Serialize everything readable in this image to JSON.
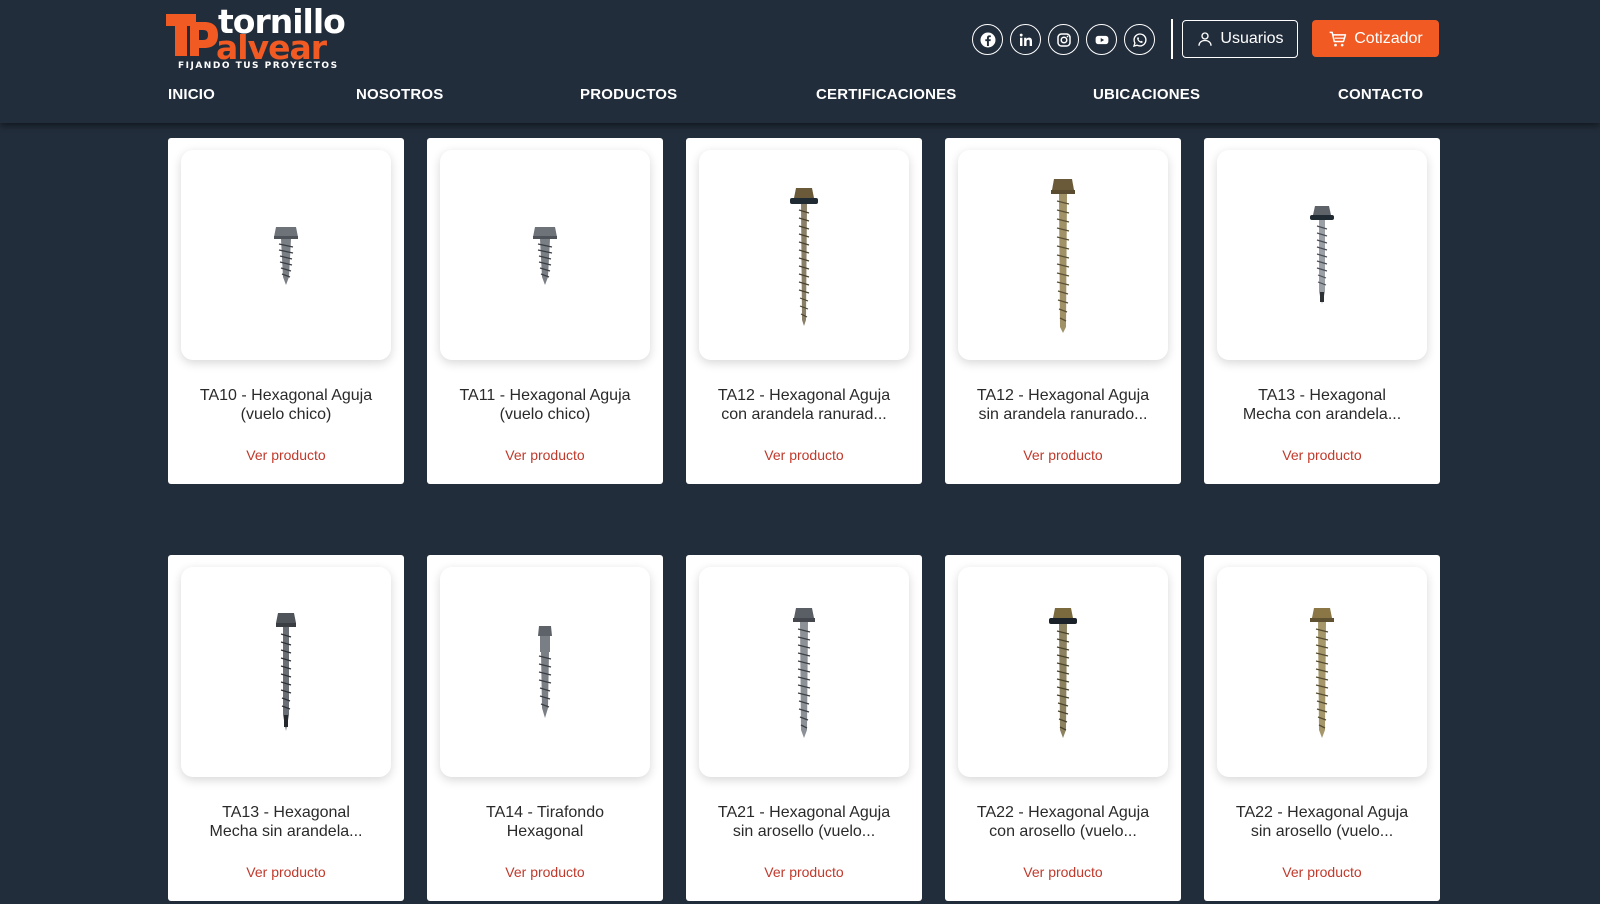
{
  "brand": {
    "name_line1": "tornillo",
    "name_line2": "alvear",
    "tagline": "FIJANDO TUS PROYECTOS",
    "accent_color": "#f15a22",
    "background_color": "#222d3b"
  },
  "social_icons": [
    "facebook-icon",
    "linkedin-icon",
    "instagram-icon",
    "youtube-icon",
    "whatsapp-icon"
  ],
  "header": {
    "users_label": "Usuarios",
    "quote_label": "Cotizador"
  },
  "nav": {
    "items": [
      "INICIO",
      "NOSOTROS",
      "PRODUCTOS",
      "CERTIFICACIONES",
      "UBICACIONES",
      "CONTACTO"
    ]
  },
  "products": [
    {
      "title": "TA10 - Hexagonal Aguja\n(vuelo chico)",
      "link": "Ver producto"
    },
    {
      "title": "TA11 - Hexagonal Aguja\n(vuelo chico)",
      "link": "Ver producto"
    },
    {
      "title": "TA12 - Hexagonal Aguja\ncon arandela ranurad...",
      "link": "Ver producto"
    },
    {
      "title": "TA12 - Hexagonal Aguja\nsin arandela ranurado...",
      "link": "Ver producto"
    },
    {
      "title": "TA13 - Hexagonal\nMecha con arandela...",
      "link": "Ver producto"
    },
    {
      "title": "TA13 - Hexagonal\nMecha sin arandela...",
      "link": "Ver producto"
    },
    {
      "title": "TA14 - Tirafondo\nHexagonal",
      "link": "Ver producto"
    },
    {
      "title": "TA21 - Hexagonal Aguja\nsin arosello (vuelo...",
      "link": "Ver producto"
    },
    {
      "title": "TA22 - Hexagonal Aguja\ncon arosello (vuelo...",
      "link": "Ver producto"
    },
    {
      "title": "TA22 - Hexagonal Aguja\nsin arosello (vuelo...",
      "link": "Ver producto"
    }
  ]
}
